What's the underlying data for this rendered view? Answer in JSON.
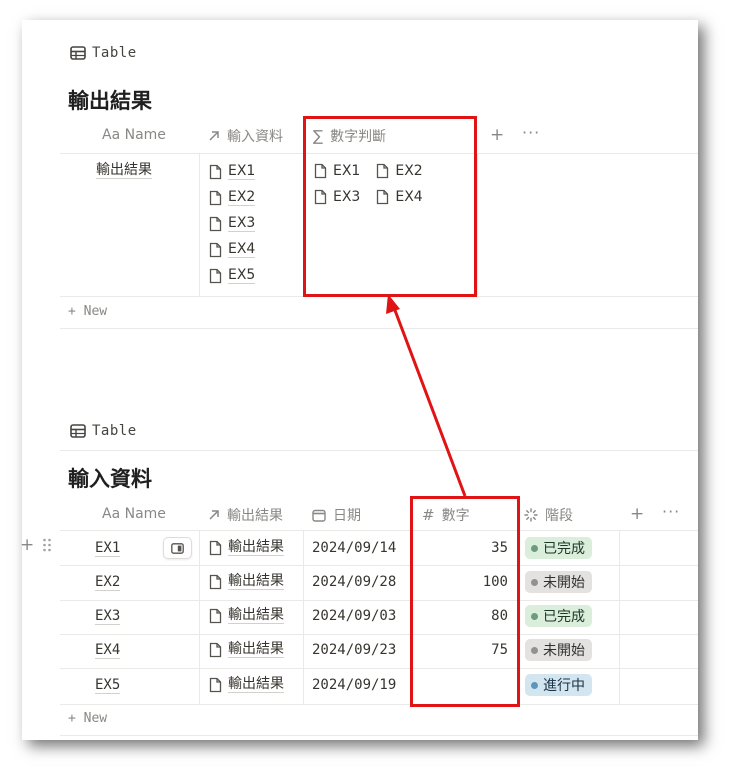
{
  "top_table": {
    "view_label": "Table",
    "title": "輸出結果",
    "headers": {
      "name": "Aa Name",
      "relation": "輸入資料",
      "rollup": "數字判斷"
    },
    "row": {
      "name": "輸出結果",
      "relations": [
        "EX1",
        "EX2",
        "EX3",
        "EX4",
        "EX5"
      ],
      "rollup_items": [
        "EX1",
        "EX2",
        "EX3",
        "EX4"
      ]
    },
    "new_label": "+ New"
  },
  "bottom_table": {
    "view_label": "Table",
    "title": "輸入資料",
    "headers": {
      "name": "Aa Name",
      "relation": "輸出結果",
      "date": "日期",
      "number": "數字",
      "status": "階段"
    },
    "rows": [
      {
        "name": "EX1",
        "relation": "輸出結果",
        "date": "2024/09/14",
        "number": "35",
        "status": "已完成"
      },
      {
        "name": "EX2",
        "relation": "輸出結果",
        "date": "2024/09/28",
        "number": "100",
        "status": "未開始"
      },
      {
        "name": "EX3",
        "relation": "輸出結果",
        "date": "2024/09/03",
        "number": "80",
        "status": "已完成"
      },
      {
        "name": "EX4",
        "relation": "輸出結果",
        "date": "2024/09/23",
        "number": "75",
        "status": "未開始"
      },
      {
        "name": "EX5",
        "relation": "輸出結果",
        "date": "2024/09/19",
        "number": "",
        "status": "進行中"
      }
    ],
    "new_label": "+ New"
  },
  "colors": {
    "annotation_red": "#e01414",
    "done_bg": "#dbeddb",
    "done_dot": "#6c9b7d",
    "notstarted_bg": "#e3e2e0",
    "notstarted_dot": "#91918e",
    "inprogress_bg": "#d3e5ef",
    "inprogress_dot": "#5b97bd"
  }
}
